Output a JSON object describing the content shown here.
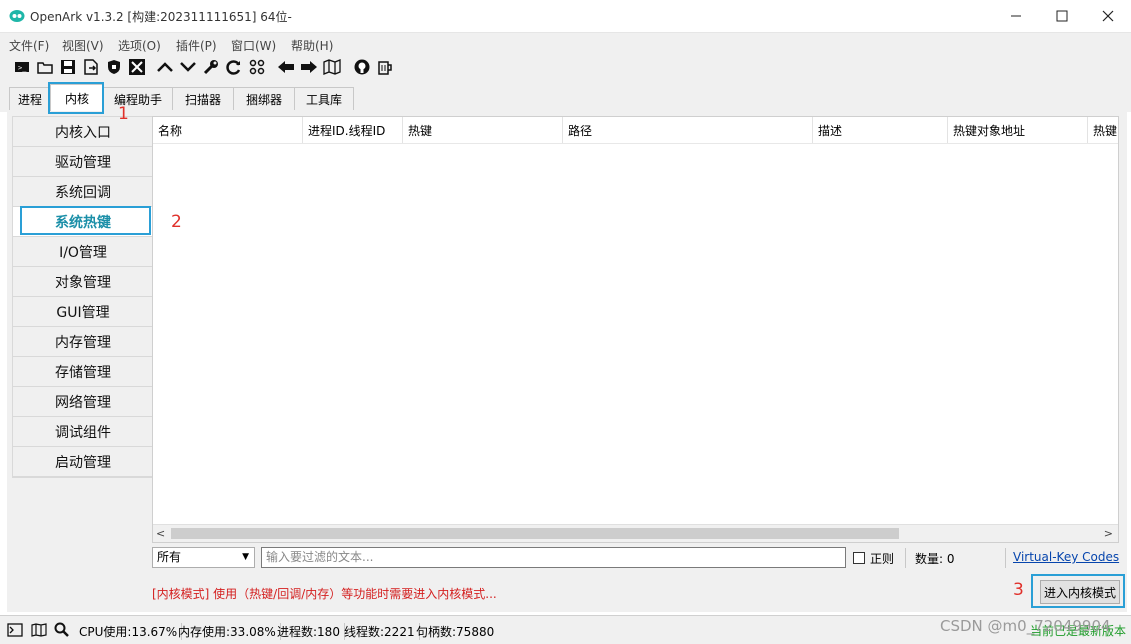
{
  "window": {
    "title": "OpenArk v1.3.2 [构建:202311111651]  64位-",
    "icon": "openark-logo-icon"
  },
  "menu": [
    "文件(F)",
    "视图(V)",
    "选项(O)",
    "插件(P)",
    "窗口(W)",
    "帮助(H)"
  ],
  "toolbar_icons": [
    "console-icon",
    "open-folder-icon",
    "save-icon",
    "export-icon",
    "shield-icon",
    "close-x-icon",
    "chevron-up-icon",
    "chevron-down-icon",
    "wrench-icon",
    "refresh-icon",
    "grid-icon",
    "arrow-left-icon",
    "arrow-right-icon",
    "map-icon",
    "github-icon",
    "beer-icon"
  ],
  "tabs": [
    "进程",
    "内核",
    "编程助手",
    "扫描器",
    "捆绑器",
    "工具库"
  ],
  "active_tab": "内核",
  "annotations": {
    "one": "1",
    "two": "2",
    "three": "3"
  },
  "sidebar": [
    "内核入口",
    "驱动管理",
    "系统回调",
    "系统热键",
    "I/O管理",
    "对象管理",
    "GUI管理",
    "内存管理",
    "存储管理",
    "网络管理",
    "调试组件",
    "启动管理"
  ],
  "active_sidebar": "系统热键",
  "table": {
    "columns": [
      "名称",
      "进程ID.线程ID",
      "热键",
      "路径",
      "描述",
      "热键对象地址",
      "热键"
    ],
    "rows": []
  },
  "filter": {
    "select_value": "所有",
    "input_placeholder": "输入要过滤的文本...",
    "regex_label": "正则",
    "count_label": "数量:  0",
    "vk_link": "Virtual-Key Codes"
  },
  "mode_note": "[内核模式] 使用（热键/回调/内存）等功能时需要进入内核模式...",
  "enter_button": "进入内核模式",
  "status": {
    "cpu": "CPU使用:13.67%",
    "mem": "内存使用:33.08%",
    "proc": "进程数:180",
    "thread": "线程数:2221",
    "handle": "句柄数:75880",
    "update": "当前已是最新版本"
  },
  "watermark": "CSDN @m0_72049904",
  "colors": {
    "highlight": "#2a9fd6",
    "annotation": "#e0302a",
    "active_text": "#1b8fa8",
    "update_green": "#1f9c2a",
    "link": "#0645ad"
  }
}
